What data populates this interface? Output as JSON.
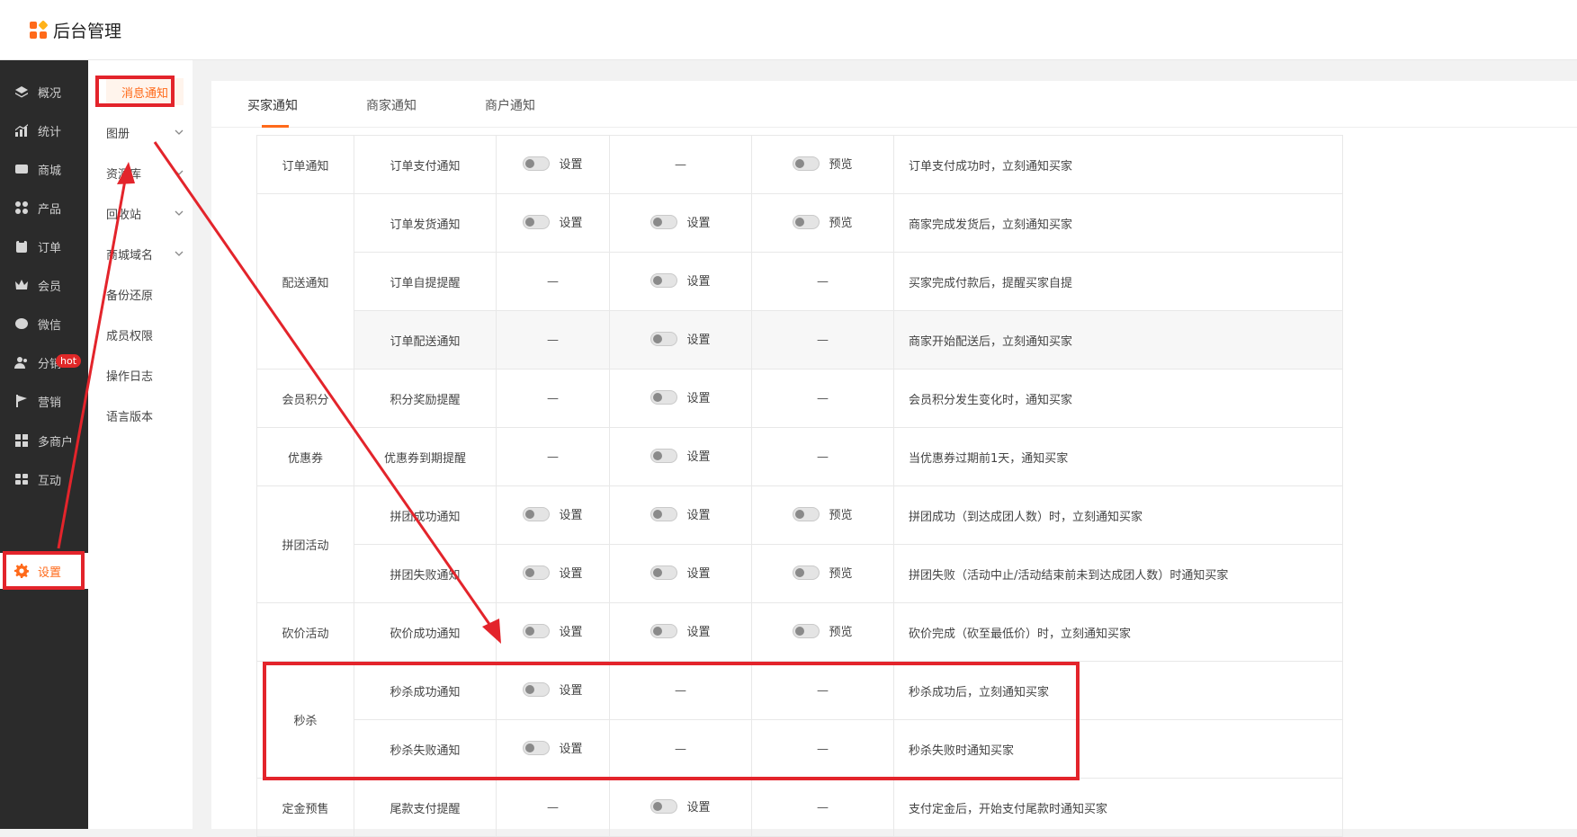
{
  "app": {
    "title": "后台管理"
  },
  "colors": {
    "accent": "#ff6a1a",
    "annotation": "#e3242b",
    "sidebar_bg": "#2b2b2b"
  },
  "sidebar": {
    "items": [
      {
        "label": "概况",
        "icon": "layers-icon"
      },
      {
        "label": "统计",
        "icon": "chart-icon"
      },
      {
        "label": "商城",
        "icon": "mail-icon"
      },
      {
        "label": "产品",
        "icon": "grid-icon"
      },
      {
        "label": "订单",
        "icon": "clipboard-icon"
      },
      {
        "label": "会员",
        "icon": "crown-icon"
      },
      {
        "label": "微信",
        "icon": "chat-icon"
      },
      {
        "label": "分销",
        "icon": "users-icon"
      },
      {
        "label": "营销",
        "icon": "flag-icon"
      },
      {
        "label": "多商户",
        "icon": "store-icon"
      },
      {
        "label": "互动",
        "icon": "blocks-icon"
      },
      {
        "label": "设置",
        "icon": "gear-icon"
      }
    ],
    "hot_badge": "hot"
  },
  "subnav": {
    "items": [
      {
        "label": "消息通知",
        "expandable": false
      },
      {
        "label": "图册",
        "expandable": true
      },
      {
        "label": "资源库",
        "expandable": true
      },
      {
        "label": "回收站",
        "expandable": true
      },
      {
        "label": "商城域名",
        "expandable": true
      },
      {
        "label": "备份还原",
        "expandable": false
      },
      {
        "label": "成员权限",
        "expandable": false
      },
      {
        "label": "操作日志",
        "expandable": false
      },
      {
        "label": "语言版本",
        "expandable": false
      }
    ]
  },
  "tabs": [
    {
      "label": "买家通知"
    },
    {
      "label": "商家通知"
    },
    {
      "label": "商户通知"
    }
  ],
  "table": {
    "set_label": "设置",
    "preview_label": "预览",
    "dash": "—",
    "groups": [
      {
        "category": "订单通知",
        "rows": [
          {
            "name": "订单支付通知",
            "c1": "set",
            "c2": "dash",
            "c3": "preview",
            "desc": "订单支付成功时，立刻通知买家"
          }
        ]
      },
      {
        "category": "配送通知",
        "rows": [
          {
            "name": "订单发货通知",
            "c1": "set",
            "c2": "set",
            "c3": "preview",
            "desc": "商家完成发货后，立刻通知买家"
          },
          {
            "name": "订单自提提醒",
            "c1": "dash",
            "c2": "set",
            "c3": "dash",
            "desc": "买家完成付款后，提醒买家自提"
          },
          {
            "name": "订单配送通知",
            "c1": "dash",
            "c2": "set",
            "c3": "dash",
            "desc": "商家开始配送后，立刻通知买家"
          }
        ]
      },
      {
        "category": "会员积分",
        "rows": [
          {
            "name": "积分奖励提醒",
            "c1": "dash",
            "c2": "set",
            "c3": "dash",
            "desc": "会员积分发生变化时，通知买家"
          }
        ]
      },
      {
        "category": "优惠券",
        "rows": [
          {
            "name": "优惠券到期提醒",
            "c1": "dash",
            "c2": "set",
            "c3": "dash",
            "desc": "当优惠券过期前1天，通知买家"
          }
        ]
      },
      {
        "category": "拼团活动",
        "rows": [
          {
            "name": "拼团成功通知",
            "c1": "set",
            "c2": "set",
            "c3": "preview",
            "desc": "拼团成功（到达成团人数）时，立刻通知买家"
          },
          {
            "name": "拼团失败通知",
            "c1": "set",
            "c2": "set",
            "c3": "preview",
            "desc": "拼团失败（活动中止/活动结束前未到达成团人数）时通知买家"
          }
        ]
      },
      {
        "category": "砍价活动",
        "rows": [
          {
            "name": "砍价成功通知",
            "c1": "set",
            "c2": "set",
            "c3": "preview",
            "desc": "砍价完成（砍至最低价）时，立刻通知买家"
          }
        ]
      },
      {
        "category": "秒杀",
        "rows": [
          {
            "name": "秒杀成功通知",
            "c1": "set",
            "c2": "dash",
            "c3": "dash",
            "desc": "秒杀成功后，立刻通知买家"
          },
          {
            "name": "秒杀失败通知",
            "c1": "set",
            "c2": "dash",
            "c3": "dash",
            "desc": "秒杀失败时通知买家"
          }
        ]
      },
      {
        "category": "定金预售",
        "rows": [
          {
            "name": "尾款支付提醒",
            "c1": "dash",
            "c2": "set",
            "c3": "dash",
            "desc": "支付定金后，开始支付尾款时通知买家"
          }
        ]
      }
    ]
  }
}
